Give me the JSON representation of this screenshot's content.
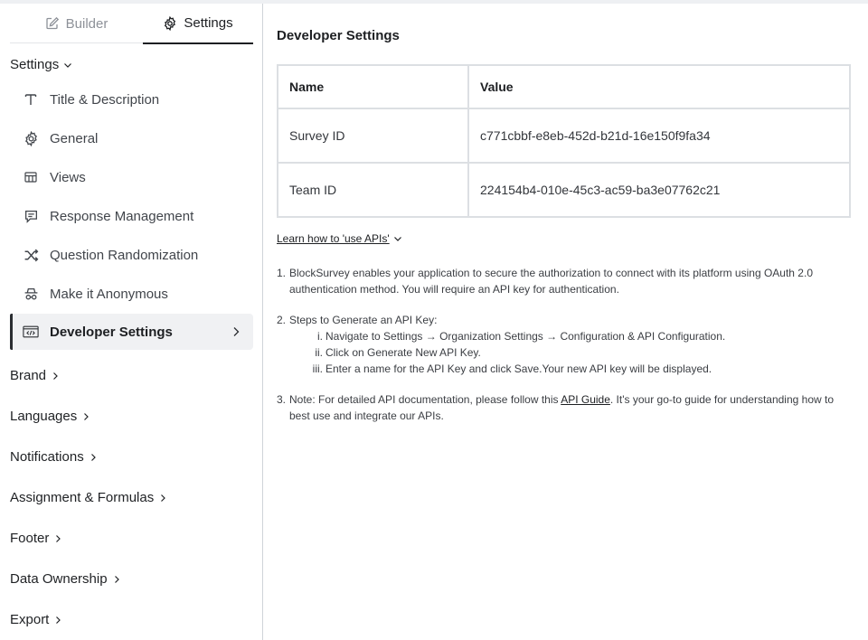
{
  "tabs": {
    "builder": "Builder",
    "settings": "Settings"
  },
  "sidebar": {
    "settings_header": "Settings",
    "items": [
      {
        "label": "Title & Description",
        "icon": "text-icon"
      },
      {
        "label": "General",
        "icon": "gear-icon"
      },
      {
        "label": "Views",
        "icon": "views-icon"
      },
      {
        "label": "Response Management",
        "icon": "response-icon"
      },
      {
        "label": "Question Randomization",
        "icon": "shuffle-icon"
      },
      {
        "label": "Make it Anonymous",
        "icon": "anonymous-icon"
      },
      {
        "label": "Developer Settings",
        "icon": "code-icon",
        "active": true
      }
    ],
    "sections": [
      "Brand",
      "Languages",
      "Notifications",
      "Assignment & Formulas",
      "Footer",
      "Data Ownership",
      "Export"
    ]
  },
  "main": {
    "title": "Developer Settings",
    "table": {
      "headers": [
        "Name",
        "Value"
      ],
      "rows": [
        [
          "Survey ID",
          "c771cbbf-e8eb-452d-b21d-16e150f9fa34"
        ],
        [
          "Team ID",
          "224154b4-010e-45c3-ac59-ba3e07762c21"
        ]
      ]
    },
    "learn_link": "Learn how to 'use APIs'",
    "steps": {
      "s1_num": "1.",
      "s1_text": "BlockSurvey enables your application to secure the authorization to connect with its platform using OAuth 2.0 authentication method. You will require an API key for authentication.",
      "s2_num": "2.",
      "s2_text": "Steps to Generate an API Key:",
      "s2_sub": [
        {
          "num": "i.",
          "text": "Navigate to Settings → Organization Settings → Configuration & API Configuration."
        },
        {
          "num": "ii.",
          "text": "Click on Generate New API Key."
        },
        {
          "num": "iii.",
          "text": "Enter a name for the API Key and click Save.Your new API key will be displayed."
        }
      ],
      "s3_num": "3.",
      "s3_pre": "Note: For detailed API documentation, please follow this ",
      "s3_link": "API Guide",
      "s3_post": ". It's your go-to guide for understanding how to best use and integrate our APIs."
    }
  }
}
